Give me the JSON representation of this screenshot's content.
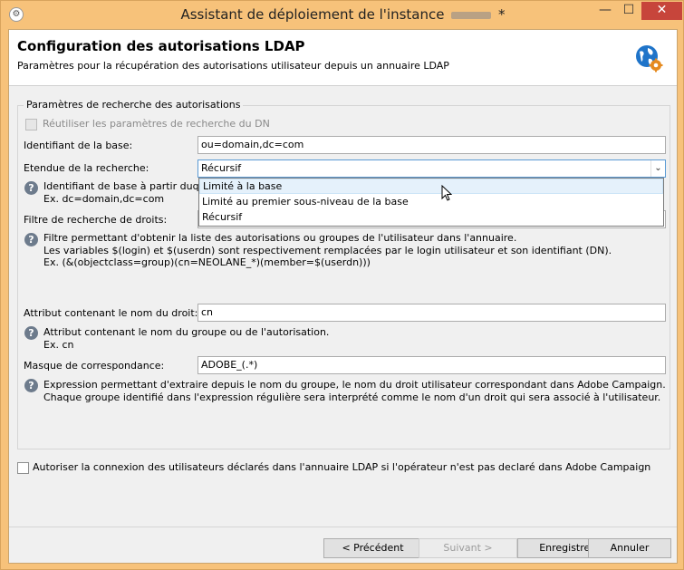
{
  "window": {
    "title_prefix": "Assistant de déploiement de l'instance",
    "title_suffix": "*",
    "minimize": "—",
    "maximize": "☐",
    "close": "✕"
  },
  "header": {
    "title": "Configuration des autorisations LDAP",
    "subtitle": "Paramètres pour la récupération des autorisations utilisateur depuis un annuaire LDAP",
    "icon": "globe-gear-icon"
  },
  "group": {
    "legend": "Paramètres de recherche des autorisations",
    "reuse_dn_label": "Réutiliser les paramètres de recherche du DN",
    "base_id_label": "Identifiant de la base:",
    "base_id_value": "ou=domain,dc=com",
    "scope_label": "Etendue de la recherche:",
    "scope_value": "Récursif",
    "scope_options": [
      "Limité à la base",
      "Limité au premier sous-niveau de la base",
      "Récursif"
    ],
    "base_help_line1": "Identifiant de base à partir duque",
    "base_help_line2": "Ex. dc=domain,dc=com",
    "filter_label": "Filtre de recherche de droits:",
    "filter_help_line1": "Filtre permettant d'obtenir la liste des autorisations ou groupes de l'utilisateur dans l'annuaire.",
    "filter_help_line2": "Les variables $(login) et $(userdn) sont respectivement remplacées par le login utilisateur et son identifiant (DN).",
    "filter_help_line3": "Ex. (&(objectclass=group)(cn=NEOLANE_*)(member=$(userdn)))",
    "attr_label": "Attribut contenant le nom du droit:",
    "attr_value": "cn",
    "attr_help_line1": "Attribut contenant le nom du groupe ou de l'autorisation.",
    "attr_help_line2": "Ex. cn",
    "mask_label": "Masque de correspondance:",
    "mask_value": "ADOBE_(.*)",
    "mask_help_line1": "Expression permettant d'extraire depuis le nom du groupe, le nom du droit utilisateur correspondant dans Adobe Campaign.",
    "mask_help_line2": "Chaque groupe identifié dans l'expression régulière sera interprété comme le nom d'un droit qui sera associé à l'utilisateur."
  },
  "allow_connection_label": "Autoriser la connexion des utilisateurs déclarés dans l'annuaire LDAP si l'opérateur n'est pas declaré dans Adobe Campaign",
  "buttons": {
    "previous": "< Précédent",
    "next": "Suivant >",
    "save": "Enregistrer",
    "cancel": "Annuler"
  },
  "colors": {
    "title_bar": "#f7c27a",
    "close_button": "#c7453b",
    "highlight": "#e5f1fb"
  }
}
